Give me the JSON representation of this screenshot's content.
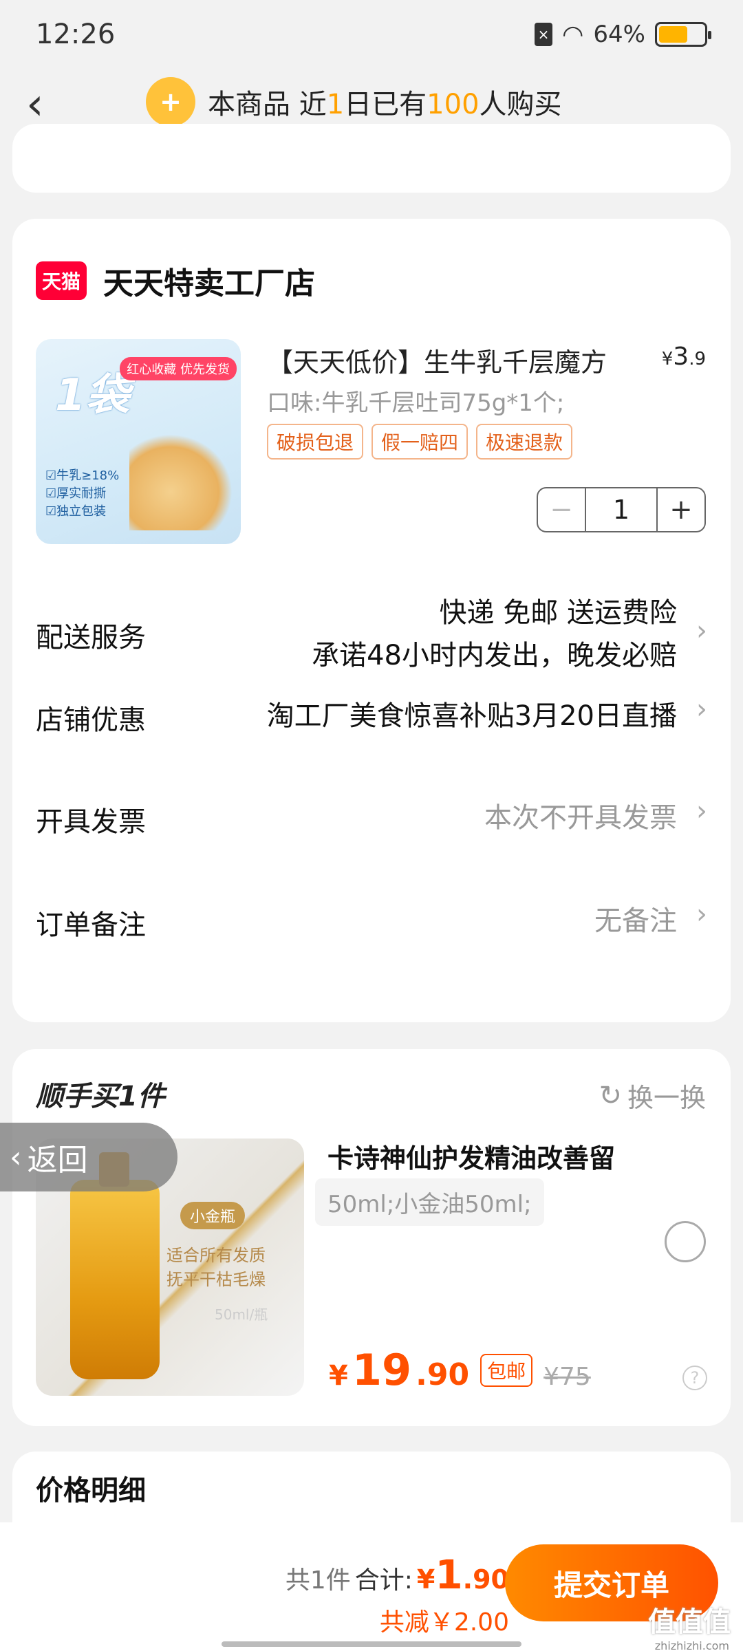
{
  "status_bar": {
    "time": "12:26",
    "battery": "64%",
    "battery_level": 0.64
  },
  "header": {
    "parts": [
      "本商品 近",
      "1",
      "日已有",
      "100",
      "人购买"
    ]
  },
  "shop": {
    "logo_text": "天猫",
    "name": "天天特卖工厂店"
  },
  "product": {
    "title": "【天天低价】生牛乳千层魔方",
    "price_symbol": "¥",
    "price_int": "3",
    "price_dec": ".9",
    "spec": "口味:牛乳千层吐司75g*1个;",
    "tags": [
      "破损包退",
      "假一赔四",
      "极速退款"
    ],
    "quantity": "1",
    "image": {
      "big_text": "1袋",
      "badge": "红心收藏 优先发货",
      "features": [
        "☑牛乳≥18%",
        "☑厚实耐撕",
        "☑独立包装"
      ]
    }
  },
  "rows": {
    "delivery": {
      "label": "配送服务",
      "line1": "快递 免邮 送运费险",
      "line2": "承诺48小时内发出，晚发必赔"
    },
    "discount": {
      "label": "店铺优惠",
      "value": "淘工厂美食惊喜补贴3月20日直播"
    },
    "invoice": {
      "label": "开具发票",
      "value": "本次不开具发票"
    },
    "remark": {
      "label": "订单备注",
      "value": "无备注"
    }
  },
  "extra": {
    "title": "顺手买1件",
    "swap_label": "换一换",
    "name": "卡诗神仙护发精油改善留",
    "spec": "50ml;小金油50ml;",
    "price_symbol": "¥",
    "price_int": "19",
    "price_dec": ".90",
    "free_ship": "包邮",
    "old_price": "¥75",
    "image": {
      "badge": "小金瓶",
      "line1": "适合所有发质",
      "line2": "抚平干枯毛燥",
      "line3": "50ml/瓶"
    }
  },
  "return_label": "返回",
  "price_detail_title": "价格明细",
  "bottom": {
    "count": "共1件",
    "total_label": "合计:",
    "total_symbol": "¥",
    "total_int": "1",
    "total_dec": ".90",
    "saved": "共减￥2.00",
    "submit": "提交订单",
    "watermark": "值值值",
    "watermark_url": "zhizhizhi.com"
  },
  "colors": {
    "accent": "#ff5000",
    "highlight": "#ffa000",
    "tmall": "#ff0036"
  }
}
